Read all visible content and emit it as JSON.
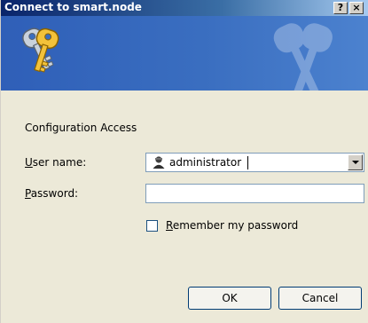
{
  "window": {
    "title": "Connect to smart.node",
    "help_button": "?",
    "close_button": "×"
  },
  "banner": {
    "icon": "keys-icon",
    "watermark_icon": "keys-watermark-icon"
  },
  "form": {
    "heading": "Configuration Access",
    "username_label_accel": "U",
    "username_label_rest": "ser name:",
    "username_value": "administrator",
    "username_icon": "user-icon",
    "password_label_accel": "P",
    "password_label_rest": "assword:",
    "password_value": "",
    "remember_accel": "R",
    "remember_rest": "emember my password",
    "remember_checked": false
  },
  "buttons": {
    "ok": "OK",
    "cancel": "Cancel"
  },
  "colors": {
    "titlebar_start": "#0a246a",
    "banner": "#3a6ec0",
    "dialog_bg": "#ece9d8"
  }
}
